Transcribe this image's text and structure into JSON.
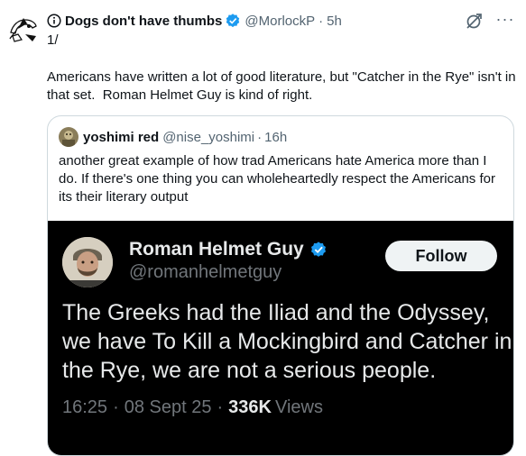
{
  "tweet": {
    "author_name": "Dogs don't have thumbs",
    "author_handle": "@MorlockP",
    "separator": "·",
    "time": "5h",
    "thread_number": "1/",
    "text": "Americans have written a lot of good literature, but \"Catcher in the Rye\" isn't in that set.  Roman Helmet Guy is kind of right.",
    "more_label": "···",
    "colors": {
      "verified": "#1d9bf0",
      "secondary_text": "#536471"
    },
    "icons": [
      "info-icon",
      "verified-badge-icon",
      "grok-icon",
      "more-icon"
    ]
  },
  "quote": {
    "author_name": "yoshimi red",
    "author_handle": "@nise_yoshimi",
    "separator": "·",
    "time": "16h",
    "text": "another great example of how trad Americans hate America more than I do. If there's one thing you can wholeheartedly respect the Americans for its their literary output"
  },
  "embed": {
    "author_name": "Roman Helmet Guy",
    "author_handle": "@romanhelmetguy",
    "follow_label": "Follow",
    "text": "The Greeks had the Iliad and the Odyssey, we have To Kill a Mockingbird and Catcher in the Rye, we are not a serious people.",
    "time": "16:25",
    "date": "08 Sept 25",
    "separator": "·",
    "views_count": "336K",
    "views_label": "Views",
    "colors": {
      "background": "#000000",
      "text": "#e7e9ea",
      "secondary": "#71767b"
    }
  }
}
